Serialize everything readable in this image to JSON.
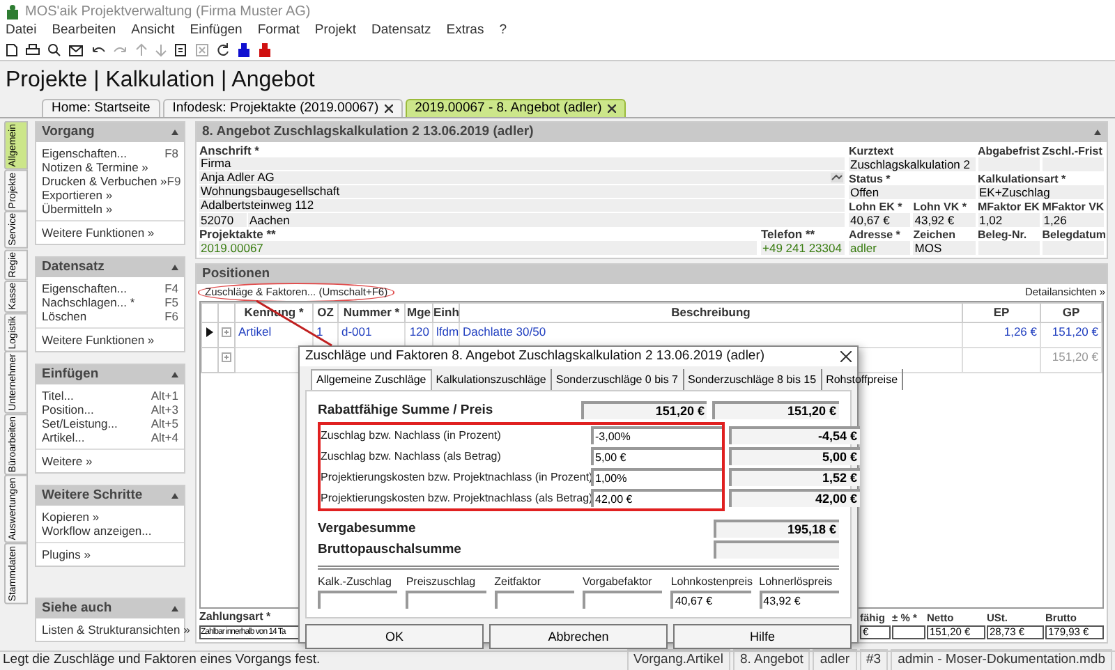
{
  "window": {
    "title": "MOS'aik Projektverwaltung (Firma Muster AG)"
  },
  "menu": [
    "Datei",
    "Bearbeiten",
    "Ansicht",
    "Einfügen",
    "Format",
    "Projekt",
    "Datensatz",
    "Extras",
    "?"
  ],
  "page_title": "Projekte | Kalkulation | Angebot",
  "doc_tabs": [
    {
      "label": "Home: Startseite",
      "selected": false,
      "closable": false
    },
    {
      "label": "Infodesk: Projektakte (2019.00067)",
      "selected": false,
      "closable": true
    },
    {
      "label": "2019.00067 - 8. Angebot (adler)",
      "selected": true,
      "closable": true
    }
  ],
  "side_tabs": [
    {
      "label": "Allgemein",
      "selected": true
    },
    {
      "label": "Projekte",
      "selected": false
    },
    {
      "label": "Service",
      "selected": false
    },
    {
      "label": "Regie",
      "selected": false
    },
    {
      "label": "Kasse",
      "selected": false
    },
    {
      "label": "Logistik",
      "selected": false
    },
    {
      "label": "Unternehmer",
      "selected": false
    },
    {
      "label": "Büroarbeiten",
      "selected": false
    },
    {
      "label": "Auswertungen",
      "selected": false
    },
    {
      "label": "Stammdaten",
      "selected": false
    }
  ],
  "side_panels": [
    {
      "title": "Vorgang",
      "sections": [
        [
          {
            "label": "Eigenschaften...",
            "shortcut": "F8"
          },
          {
            "label": "Notizen & Termine »"
          },
          {
            "label": "Drucken & Verbuchen »",
            "shortcut": "F9"
          },
          {
            "label": "Exportieren »"
          },
          {
            "label": "Übermitteln »"
          }
        ],
        [
          {
            "label": "Weitere Funktionen »"
          }
        ]
      ]
    },
    {
      "title": "Datensatz",
      "sections": [
        [
          {
            "label": "Eigenschaften...",
            "shortcut": "F4"
          },
          {
            "label": "Nachschlagen... *",
            "shortcut": "F5"
          },
          {
            "label": "Löschen",
            "shortcut": "F6"
          }
        ],
        [
          {
            "label": "Weitere Funktionen »"
          }
        ]
      ]
    },
    {
      "title": "Einfügen",
      "sections": [
        [
          {
            "label": "Titel...",
            "shortcut": "Alt+1"
          },
          {
            "label": "Position...",
            "shortcut": "Alt+3"
          },
          {
            "label": "Set/Leistung...",
            "shortcut": "Alt+5"
          },
          {
            "label": "Artikel...",
            "shortcut": "Alt+4"
          }
        ],
        [
          {
            "label": "Weitere »"
          }
        ]
      ]
    },
    {
      "title": "Weitere Schritte",
      "sections": [
        [
          {
            "label": "Kopieren »"
          },
          {
            "label": "Workflow anzeigen..."
          }
        ],
        [
          {
            "label": "Plugins »"
          }
        ]
      ]
    },
    {
      "title": "Siehe auch",
      "sections": [
        [
          {
            "label": "Listen & Strukturansichten »"
          }
        ]
      ]
    }
  ],
  "record": {
    "title": "8. Angebot Zuschlagskalkulation 2 13.06.2019 (adler)",
    "address_label": "Anschrift *",
    "address_lines": [
      "Firma",
      "Anja Adler AG",
      "Wohnungsbaugesellschaft",
      "Adalbertsteinweg 112"
    ],
    "zip": "52070",
    "city": "Aachen",
    "project_file": {
      "label": "Projektakte **",
      "value": "2019.00067",
      "linked": true
    },
    "phone": {
      "label": "Telefon **",
      "value": "+49 241 23304",
      "linked": true
    },
    "fields": [
      {
        "label": "Kurztext",
        "value": "Zuschlagskalkulation 2",
        "linked": false
      },
      {
        "label": "Abgabefrist"
      },
      {
        "label": "Zschl.-Frist"
      },
      {
        "label": "Status *",
        "value": "Offen",
        "linked": false
      },
      {
        "label": "Kalkulationsart *",
        "value": "EK+Zuschlag",
        "linked": false
      },
      {
        "label": "Lohn EK *",
        "value": "40,67 €",
        "linked": false
      },
      {
        "label": "Lohn VK *",
        "value": "43,92 €",
        "linked": false
      },
      {
        "label": "MFaktor EK",
        "value": "1,02",
        "linked": false
      },
      {
        "label": "MFaktor VK",
        "value": "1,26",
        "linked": false
      },
      {
        "label": "Adresse *",
        "value": "adler",
        "linked": true
      },
      {
        "label": "Zeichen",
        "value": "MOS",
        "linked": false
      },
      {
        "label": "Beleg-Nr."
      },
      {
        "label": "Belegdatum"
      }
    ]
  },
  "positions": {
    "title": "Positionen",
    "action": "Zuschläge & Faktoren... (Umschalt+F6)",
    "views": "Detailansichten »",
    "columns": [
      "Kennung *",
      "OZ",
      "Nummer *",
      "Mge",
      "Einh",
      "Beschreibung",
      "EP",
      "GP"
    ],
    "rows": [
      {
        "current": true,
        "kind": "article",
        "cells": [
          "Artikel",
          "1",
          "d-001",
          "120",
          "lfdm",
          "Dachlatte 30/50",
          "1,26 €",
          "151,20 €"
        ]
      },
      {
        "current": false,
        "kind": "blank",
        "cells": [
          null,
          null,
          null,
          null,
          null,
          null,
          null,
          "151,20 €"
        ]
      }
    ],
    "payment_label": "Zahlungsart *",
    "payment_value": "Zahlbar innerhalb von 14 Ta",
    "totals": [
      {
        "label": "fähig",
        "value": "€"
      },
      {
        "label": "± % *"
      },
      {
        "label": "Netto",
        "value": "151,20 €"
      },
      {
        "label": "USt.",
        "value": "28,73 €"
      },
      {
        "label": "Brutto",
        "value": "179,93 €"
      }
    ]
  },
  "dialog": {
    "title": "Zuschläge und Faktoren 8. Angebot Zuschlagskalkulation 2 13.06.2019 (adler)",
    "tabs": [
      {
        "label": "Allgemeine Zuschläge",
        "selected": true
      },
      {
        "label": "Kalkulationszuschläge",
        "selected": false
      },
      {
        "label": "Sonderzuschläge 0 bis 7",
        "selected": false
      },
      {
        "label": "Sonderzuschläge 8 bis 15",
        "selected": false
      },
      {
        "label": "Rohstoffpreise",
        "selected": false
      }
    ],
    "summary": {
      "label": "Rabattfähige Summe / Preis",
      "input": "151,20 €",
      "result": "151,20 €"
    },
    "rows_highlighted": true,
    "rows": [
      {
        "label": "Zuschlag bzw. Nachlass (in Prozent)",
        "input": "-3,00%",
        "result": "-4,54 €"
      },
      {
        "label": "Zuschlag bzw. Nachlass (als Betrag)",
        "input": "5,00 €",
        "result": "5,00 €"
      },
      {
        "label": "Projektierungskosten bzw. Projektnachlass (in Prozent)",
        "input": "1,00%",
        "result": "1,52 €"
      },
      {
        "label": "Projektierungskosten bzw. Projektnachlass (als Betrag)",
        "input": "42,00 €",
        "result": "42,00 €"
      }
    ],
    "totals": [
      {
        "label": "Vergabesumme",
        "result": "195,18 €"
      },
      {
        "label": "Bruttopauschalsumme"
      }
    ],
    "factors": [
      {
        "label": "Kalk.-Zuschlag"
      },
      {
        "label": "Preiszuschlag"
      },
      {
        "label": "Zeitfaktor"
      },
      {
        "label": "Vorgabefaktor"
      },
      {
        "label": "Lohnkostenpreis",
        "value": "40,67 €"
      },
      {
        "label": "Lohnerlöspreis",
        "value": "43,92 €"
      }
    ],
    "buttons": [
      "OK",
      "Abbrechen",
      "Hilfe"
    ]
  },
  "status_bar": {
    "message": "Legt die Zuschläge und Faktoren eines Vorgangs fest.",
    "cells": [
      "Vorgang.Artikel",
      "8. Angebot",
      "adler",
      "#3",
      "admin - Moser-Dokumentation.mdb"
    ]
  }
}
